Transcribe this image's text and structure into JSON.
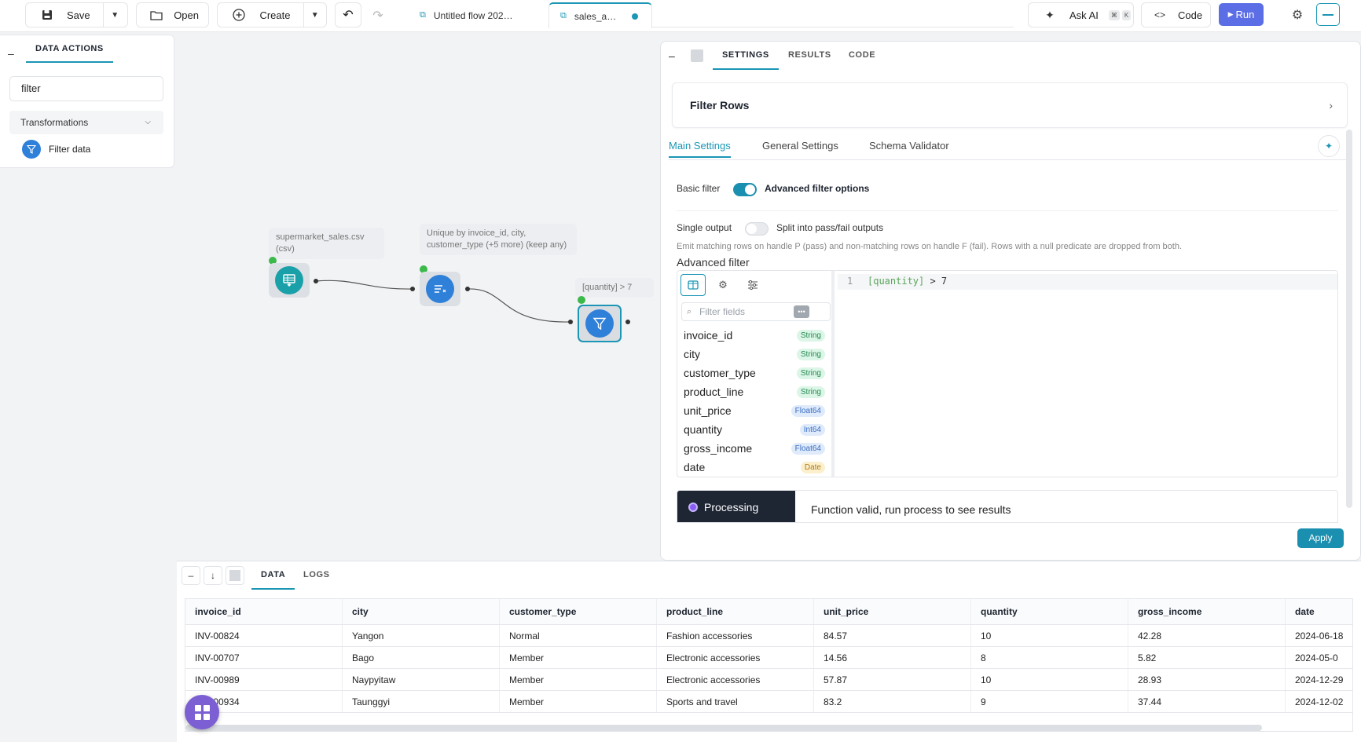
{
  "toolbar": {
    "save": "Save",
    "open": "Open",
    "create": "Create",
    "ask_ai": "Ask AI",
    "kbd_mod": "⌘",
    "kbd_key": "K",
    "code": "Code",
    "run": "Run"
  },
  "file_tabs": [
    {
      "label": "Untitled flow 202…",
      "active": false
    },
    {
      "label": "sales_a…",
      "active": true
    }
  ],
  "left_panel": {
    "tab": "DATA ACTIONS",
    "search_value": "filter",
    "group": "Transformations",
    "item": "Filter data"
  },
  "canvas": {
    "nodes": [
      {
        "label": "supermarket_sales.csv (csv)"
      },
      {
        "label": "Unique by invoice_id, city, customer_type (+5 more) (keep any)"
      },
      {
        "label": "[quantity] > 7"
      }
    ]
  },
  "settings": {
    "tabs": [
      "SETTINGS",
      "RESULTS",
      "CODE"
    ],
    "title": "Filter Rows",
    "subtabs": [
      "Main Settings",
      "General Settings",
      "Schema Validator"
    ],
    "basic_filter": "Basic filter",
    "advanced_options": "Advanced filter options",
    "single_output": "Single output",
    "split_outputs": "Split into pass/fail outputs",
    "description": "Emit matching rows on handle P (pass) and non-matching rows on handle F (fail). Rows with a null predicate are dropped from both.",
    "advanced_filter_label": "Advanced filter",
    "filter_fields_placeholder": "Filter fields",
    "more_icon_text": "•••",
    "fields": [
      {
        "name": "invoice_id",
        "type": "String"
      },
      {
        "name": "city",
        "type": "String"
      },
      {
        "name": "customer_type",
        "type": "String"
      },
      {
        "name": "product_line",
        "type": "String"
      },
      {
        "name": "unit_price",
        "type": "Float64"
      },
      {
        "name": "quantity",
        "type": "Int64"
      },
      {
        "name": "gross_income",
        "type": "Float64"
      },
      {
        "name": "date",
        "type": "Date"
      }
    ],
    "code_line_number": "1",
    "code_column": "[quantity]",
    "code_rest": " > 7",
    "processing": "Processing",
    "status_message": "Function valid, run process to see results",
    "apply": "Apply"
  },
  "bottom": {
    "tabs": [
      "DATA",
      "LOGS"
    ],
    "columns": [
      "invoice_id",
      "city",
      "customer_type",
      "product_line",
      "unit_price",
      "quantity",
      "gross_income",
      "date"
    ],
    "rows": [
      [
        "INV-00824",
        "Yangon",
        "Normal",
        "Fashion accessories",
        "84.57",
        "10",
        "42.28",
        "2024-06-18"
      ],
      [
        "INV-00707",
        "Bago",
        "Member",
        "Electronic accessories",
        "14.56",
        "8",
        "5.82",
        "2024-05-0"
      ],
      [
        "INV-00989",
        "Naypyitaw",
        "Member",
        "Electronic accessories",
        "57.87",
        "10",
        "28.93",
        "2024-12-29"
      ],
      [
        "INV-00934",
        "Taunggyi",
        "Member",
        "Sports and travel",
        "83.2",
        "9",
        "37.44",
        "2024-12-02"
      ]
    ]
  },
  "colors": {
    "accent": "#1b96b5",
    "run": "#5c6ee6",
    "fab": "#7b5fd3"
  }
}
